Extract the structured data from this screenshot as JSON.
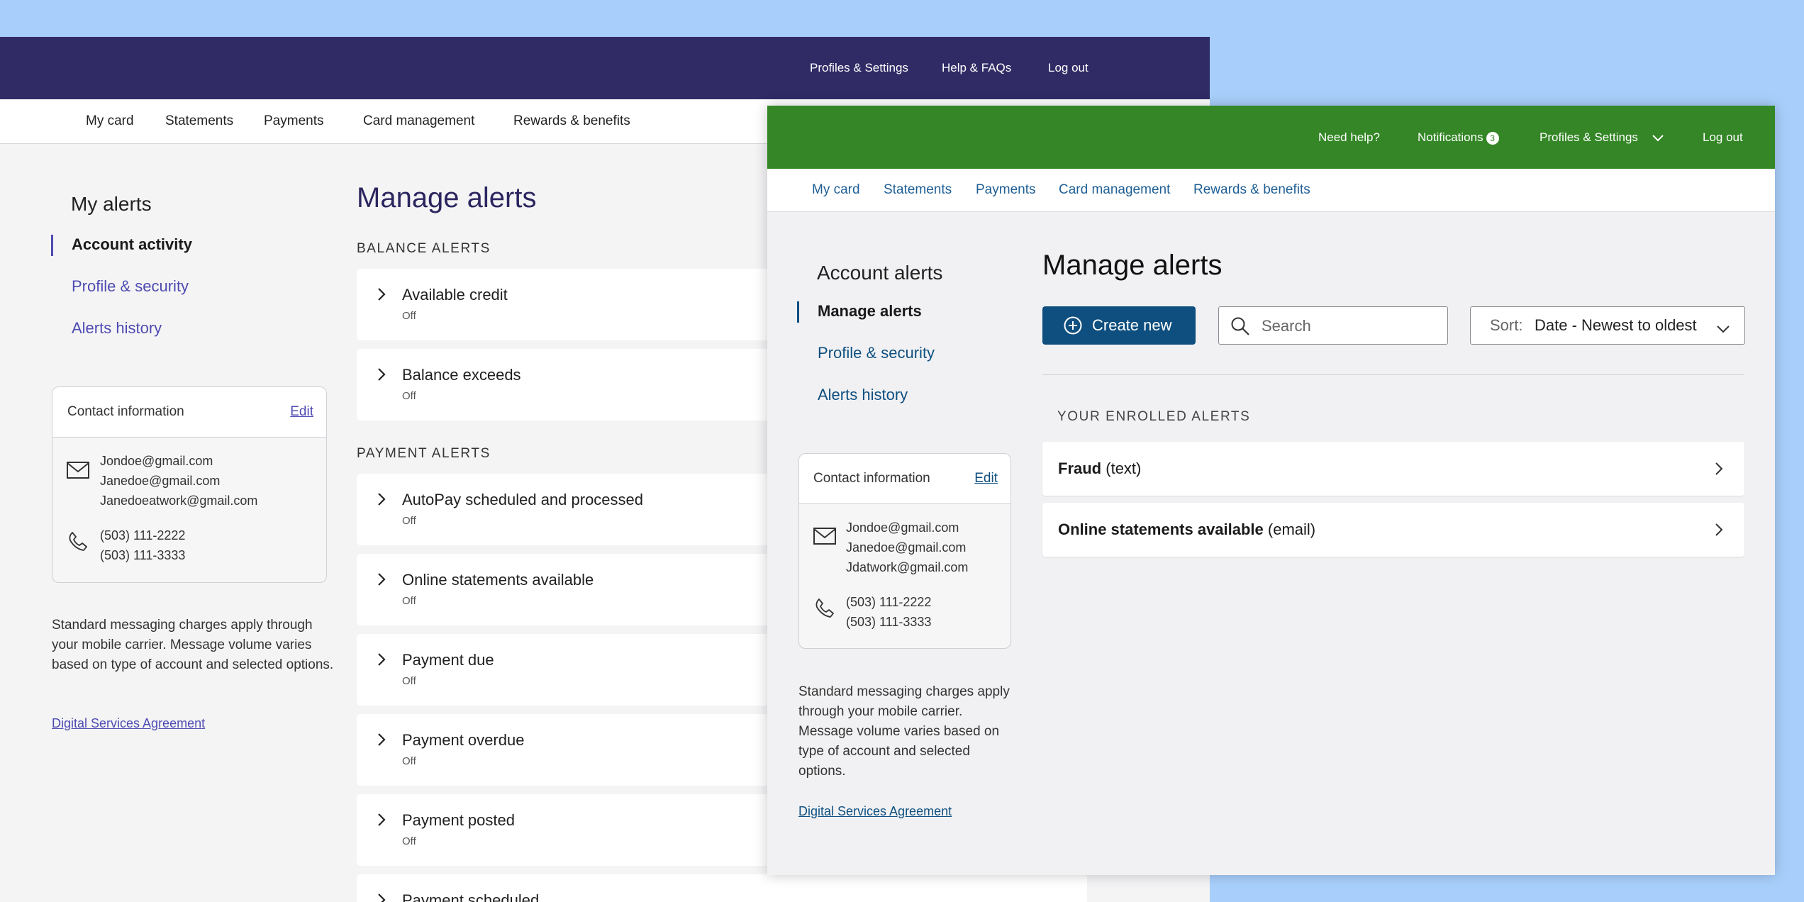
{
  "window_a": {
    "header": {
      "util_links": [
        "Profiles & Settings",
        "Help & FAQs",
        "Log out"
      ]
    },
    "nav": [
      "My card",
      "Statements",
      "Payments",
      "Card management",
      "Rewards & benefits"
    ],
    "sidebar": {
      "title": "My alerts",
      "items": [
        {
          "label": "Account activity",
          "active": true
        },
        {
          "label": "Profile & security",
          "active": false
        },
        {
          "label": "Alerts history",
          "active": false
        }
      ]
    },
    "contact": {
      "title": "Contact information",
      "edit": "Edit",
      "emails": [
        "Jondoe@gmail.com",
        "Janedoe@gmail.com",
        "Janedoeatwork@gmail.com"
      ],
      "phones": [
        "(503) 111-2222",
        "(503) 111-3333"
      ]
    },
    "disclaimer": "Standard messaging charges apply through your mobile carrier. Message volume varies based on type of account and selected options.",
    "dsa": "Digital Services Agreement",
    "main": {
      "title": "Manage alerts",
      "balance_section": "BALANCE ALERTS",
      "balance_alerts": [
        {
          "label": "Available credit",
          "status": "Off"
        },
        {
          "label": "Balance exceeds",
          "status": "Off"
        }
      ],
      "payment_section": "PAYMENT ALERTS",
      "payment_alerts": [
        {
          "label": "AutoPay scheduled and processed",
          "status": "Off"
        },
        {
          "label": "Online statements available",
          "status": "Off"
        },
        {
          "label": "Payment due",
          "status": "Off"
        },
        {
          "label": "Payment overdue",
          "status": "Off"
        },
        {
          "label": "Payment posted",
          "status": "Off"
        },
        {
          "label": "Payment scheduled",
          "status": ""
        }
      ]
    },
    "colors": {
      "header": "#302a65",
      "accent": "#4e4bb2"
    }
  },
  "window_b": {
    "header": {
      "need_help": "Need help?",
      "notifications": "Notifications",
      "notifications_count": "3",
      "profiles": "Profiles & Settings",
      "logout": "Log out"
    },
    "nav": [
      "My card",
      "Statements",
      "Payments",
      "Card management",
      "Rewards & benefits"
    ],
    "sidebar": {
      "title": "Account alerts",
      "items": [
        {
          "label": "Manage alerts",
          "active": true
        },
        {
          "label": "Profile & security",
          "active": false
        },
        {
          "label": "Alerts history",
          "active": false
        }
      ]
    },
    "contact": {
      "title": "Contact information",
      "edit": "Edit",
      "emails": [
        "Jondoe@gmail.com",
        "Janedoe@gmail.com",
        "Jdatwork@gmail.com"
      ],
      "phones": [
        "(503) 111-2222",
        "(503) 111-3333"
      ]
    },
    "disclaimer": "Standard messaging charges apply through your mobile carrier. Message volume varies based on type of account and selected options.",
    "dsa": "Digital Services Agreement",
    "main": {
      "title": "Manage alerts",
      "create_new": "Create new",
      "search_placeholder": "Search",
      "sort_prefix": "Sort:",
      "sort_value": "Date - Newest to oldest",
      "section": "YOUR ENROLLED ALERTS",
      "alerts": [
        {
          "name": "Fraud",
          "channel": "(text)"
        },
        {
          "name": "Online statements available",
          "channel": "(email)"
        }
      ]
    },
    "colors": {
      "header": "#348626",
      "accent": "#0e4f80"
    }
  }
}
